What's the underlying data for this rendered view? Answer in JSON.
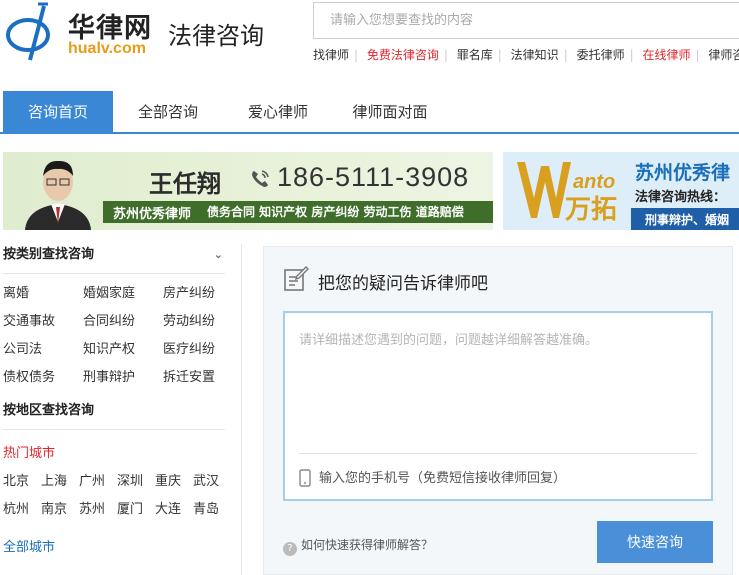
{
  "logo": {
    "name_cn": "华律网",
    "name_en": "hualv.com",
    "subtitle": "法律咨询"
  },
  "search": {
    "placeholder": "请输入您想要查找的内容"
  },
  "quick_links": [
    {
      "label": "找律师",
      "highlight": false
    },
    {
      "label": "免费法律咨询",
      "highlight": true
    },
    {
      "label": "罪名库",
      "highlight": false
    },
    {
      "label": "法律知识",
      "highlight": false
    },
    {
      "label": "委托律师",
      "highlight": false
    },
    {
      "label": "在线律师",
      "highlight": true
    },
    {
      "label": "律师咨询",
      "highlight": false
    }
  ],
  "nav": {
    "tabs": [
      {
        "label": "咨询首页",
        "active": true
      },
      {
        "label": "全部咨询",
        "active": false
      },
      {
        "label": "爱心律师",
        "active": false
      },
      {
        "label": "律师面对面",
        "active": false
      }
    ]
  },
  "banner1": {
    "name": "王任翔",
    "phone": "186-5111-3908",
    "title": "苏州优秀律师",
    "tags": "债务合同 知识产权 房产纠纷 劳动工伤 道路赔偿"
  },
  "banner2": {
    "logo_text": "anto",
    "logo_cn": "万拓",
    "title": "苏州优秀律",
    "hotline": "法律咨询热线：",
    "bar": "刑事辩护、婚姻"
  },
  "sidebar": {
    "category_title": "按类别查找咨询",
    "categories": [
      [
        "离婚",
        "婚姻家庭",
        "房产纠纷"
      ],
      [
        "交通事故",
        "合同纠纷",
        "劳动纠纷"
      ],
      [
        "公司法",
        "知识产权",
        "医疗纠纷"
      ],
      [
        "债权债务",
        "刑事辩护",
        "拆迁安置"
      ]
    ],
    "region_title": "按地区查找咨询",
    "hot_cities_title": "热门城市",
    "cities": [
      [
        "北京",
        "上海",
        "广州",
        "深圳",
        "重庆",
        "武汉"
      ],
      [
        "杭州",
        "南京",
        "苏州",
        "厦门",
        "大连",
        "青岛"
      ]
    ],
    "all_cities": "全部城市"
  },
  "consult": {
    "title": "把您的疑问告诉律师吧",
    "question_placeholder": "请详细描述您遇到的问题，问题越详细解答越准确。",
    "phone_placeholder": "输入您的手机号（免费短信接收律师回复）",
    "help_text": "如何快速获得律师解答？",
    "submit_label": "快速咨询"
  },
  "colors": {
    "accent": "#3a87d6",
    "highlight": "#e0262c",
    "brand_orange": "#e89c1a"
  }
}
